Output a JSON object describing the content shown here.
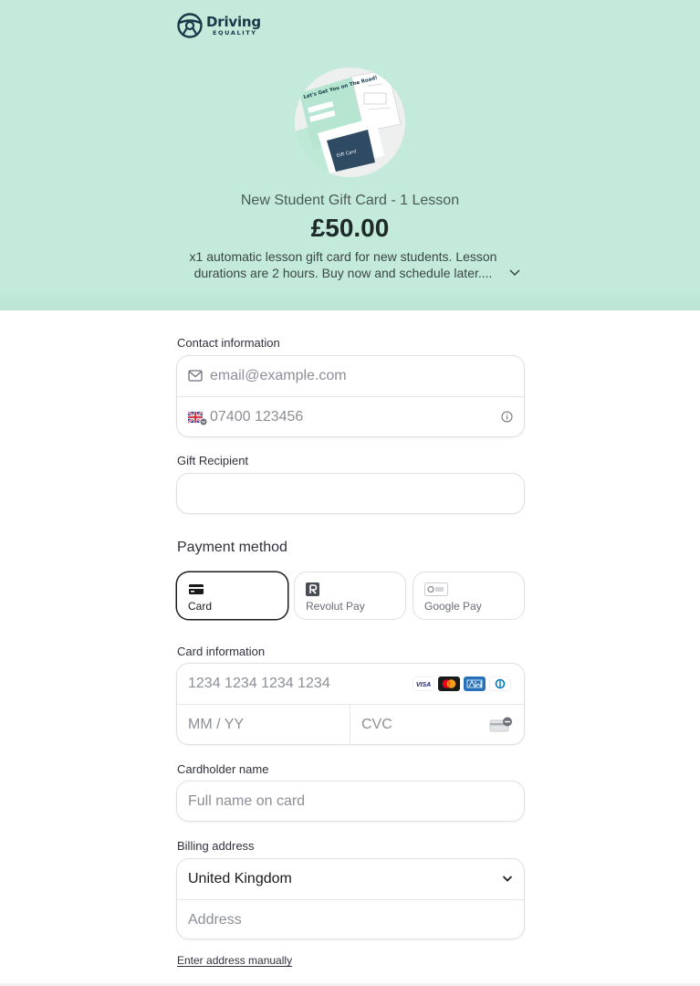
{
  "brand": {
    "name_top": "Driving",
    "name_bottom": "EQUALITY"
  },
  "product": {
    "title": "New Student Gift Card - 1 Lesson",
    "price": "£50.00",
    "description": "x1 automatic lesson gift card for new students. Lesson durations are 2 hours. Buy now and schedule later....",
    "thumb_headline": "Let's Get You on The Road!",
    "thumb_card_label": "Gift Card"
  },
  "contact": {
    "label": "Contact information",
    "email_placeholder": "email@example.com",
    "phone_placeholder": "07400 123456"
  },
  "gift_recipient": {
    "label": "Gift Recipient",
    "value": ""
  },
  "payment": {
    "title": "Payment method",
    "methods": [
      {
        "label": "Card",
        "selected": true
      },
      {
        "label": "Revolut Pay",
        "selected": false
      },
      {
        "label": "Google Pay",
        "selected": false
      }
    ]
  },
  "card": {
    "label": "Card information",
    "number_placeholder": "1234 1234 1234 1234",
    "expiry_placeholder": "MM / YY",
    "cvc_placeholder": "CVC",
    "brands": [
      "visa",
      "mastercard",
      "amex",
      "diners"
    ],
    "brand_visa_text": "VISA"
  },
  "cardholder": {
    "label": "Cardholder name",
    "placeholder": "Full name on card"
  },
  "billing": {
    "label": "Billing address",
    "country": "United Kingdom",
    "address_placeholder": "Address",
    "manual_link": "Enter address manually"
  },
  "colors": {
    "header_bg": "#c3eadb",
    "brand_navy": "#173a48",
    "selected_border": "#1a1a1a"
  }
}
